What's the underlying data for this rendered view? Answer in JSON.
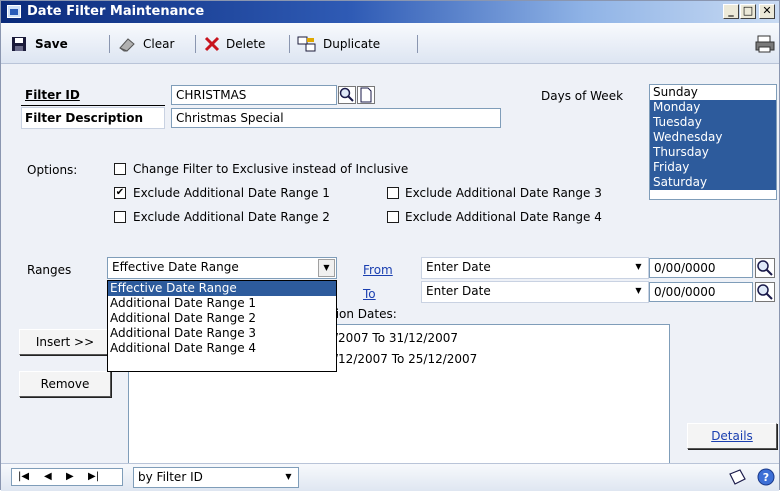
{
  "window": {
    "title": "Date Filter Maintenance"
  },
  "toolbar": {
    "save_label": "Save",
    "clear_label": "Clear",
    "delete_label": "Delete",
    "duplicate_label": "Duplicate"
  },
  "form": {
    "filter_id_label": "Filter ID",
    "filter_id_value": "CHRISTMAS",
    "filter_desc_label": "Filter Description",
    "filter_desc_value": "Christmas Special",
    "days_label": "Days of Week",
    "days": [
      "Sunday",
      "Monday",
      "Tuesday",
      "Wednesday",
      "Thursday",
      "Friday",
      "Saturday"
    ],
    "days_selected": [
      false,
      true,
      true,
      true,
      true,
      true,
      true
    ]
  },
  "options": {
    "label": "Options:",
    "change_exclusive": "Change Filter to Exclusive instead of Inclusive",
    "excl1": "Exclude Additional Date Range 1",
    "excl2": "Exclude Additional Date Range 2",
    "excl3": "Exclude Additional Date Range 3",
    "excl4": "Exclude Additional Date Range 4",
    "checked": {
      "change_exclusive": false,
      "excl1": true,
      "excl2": false,
      "excl3": false,
      "excl4": false
    }
  },
  "ranges": {
    "label": "Ranges",
    "selected": "Effective Date Range",
    "options": [
      "Effective Date Range",
      "Additional Date Range 1",
      "Additional Date Range 2",
      "Additional Date Range 3",
      "Additional Date Range 4"
    ],
    "from_label": "From",
    "to_label": "To",
    "from_combo": "Enter Date",
    "to_combo": "Enter Date",
    "from_date": "0/00/0000",
    "to_date": "0/00/0000"
  },
  "dates_list": {
    "header_partial": "tion Dates:",
    "rows_partial": [
      "/2007 To 31/12/2007",
      "/12/2007 To 25/12/2007"
    ]
  },
  "buttons": {
    "insert": "Insert >>",
    "remove": "Remove",
    "details": "Details"
  },
  "status": {
    "sort_value": "by Filter ID"
  }
}
